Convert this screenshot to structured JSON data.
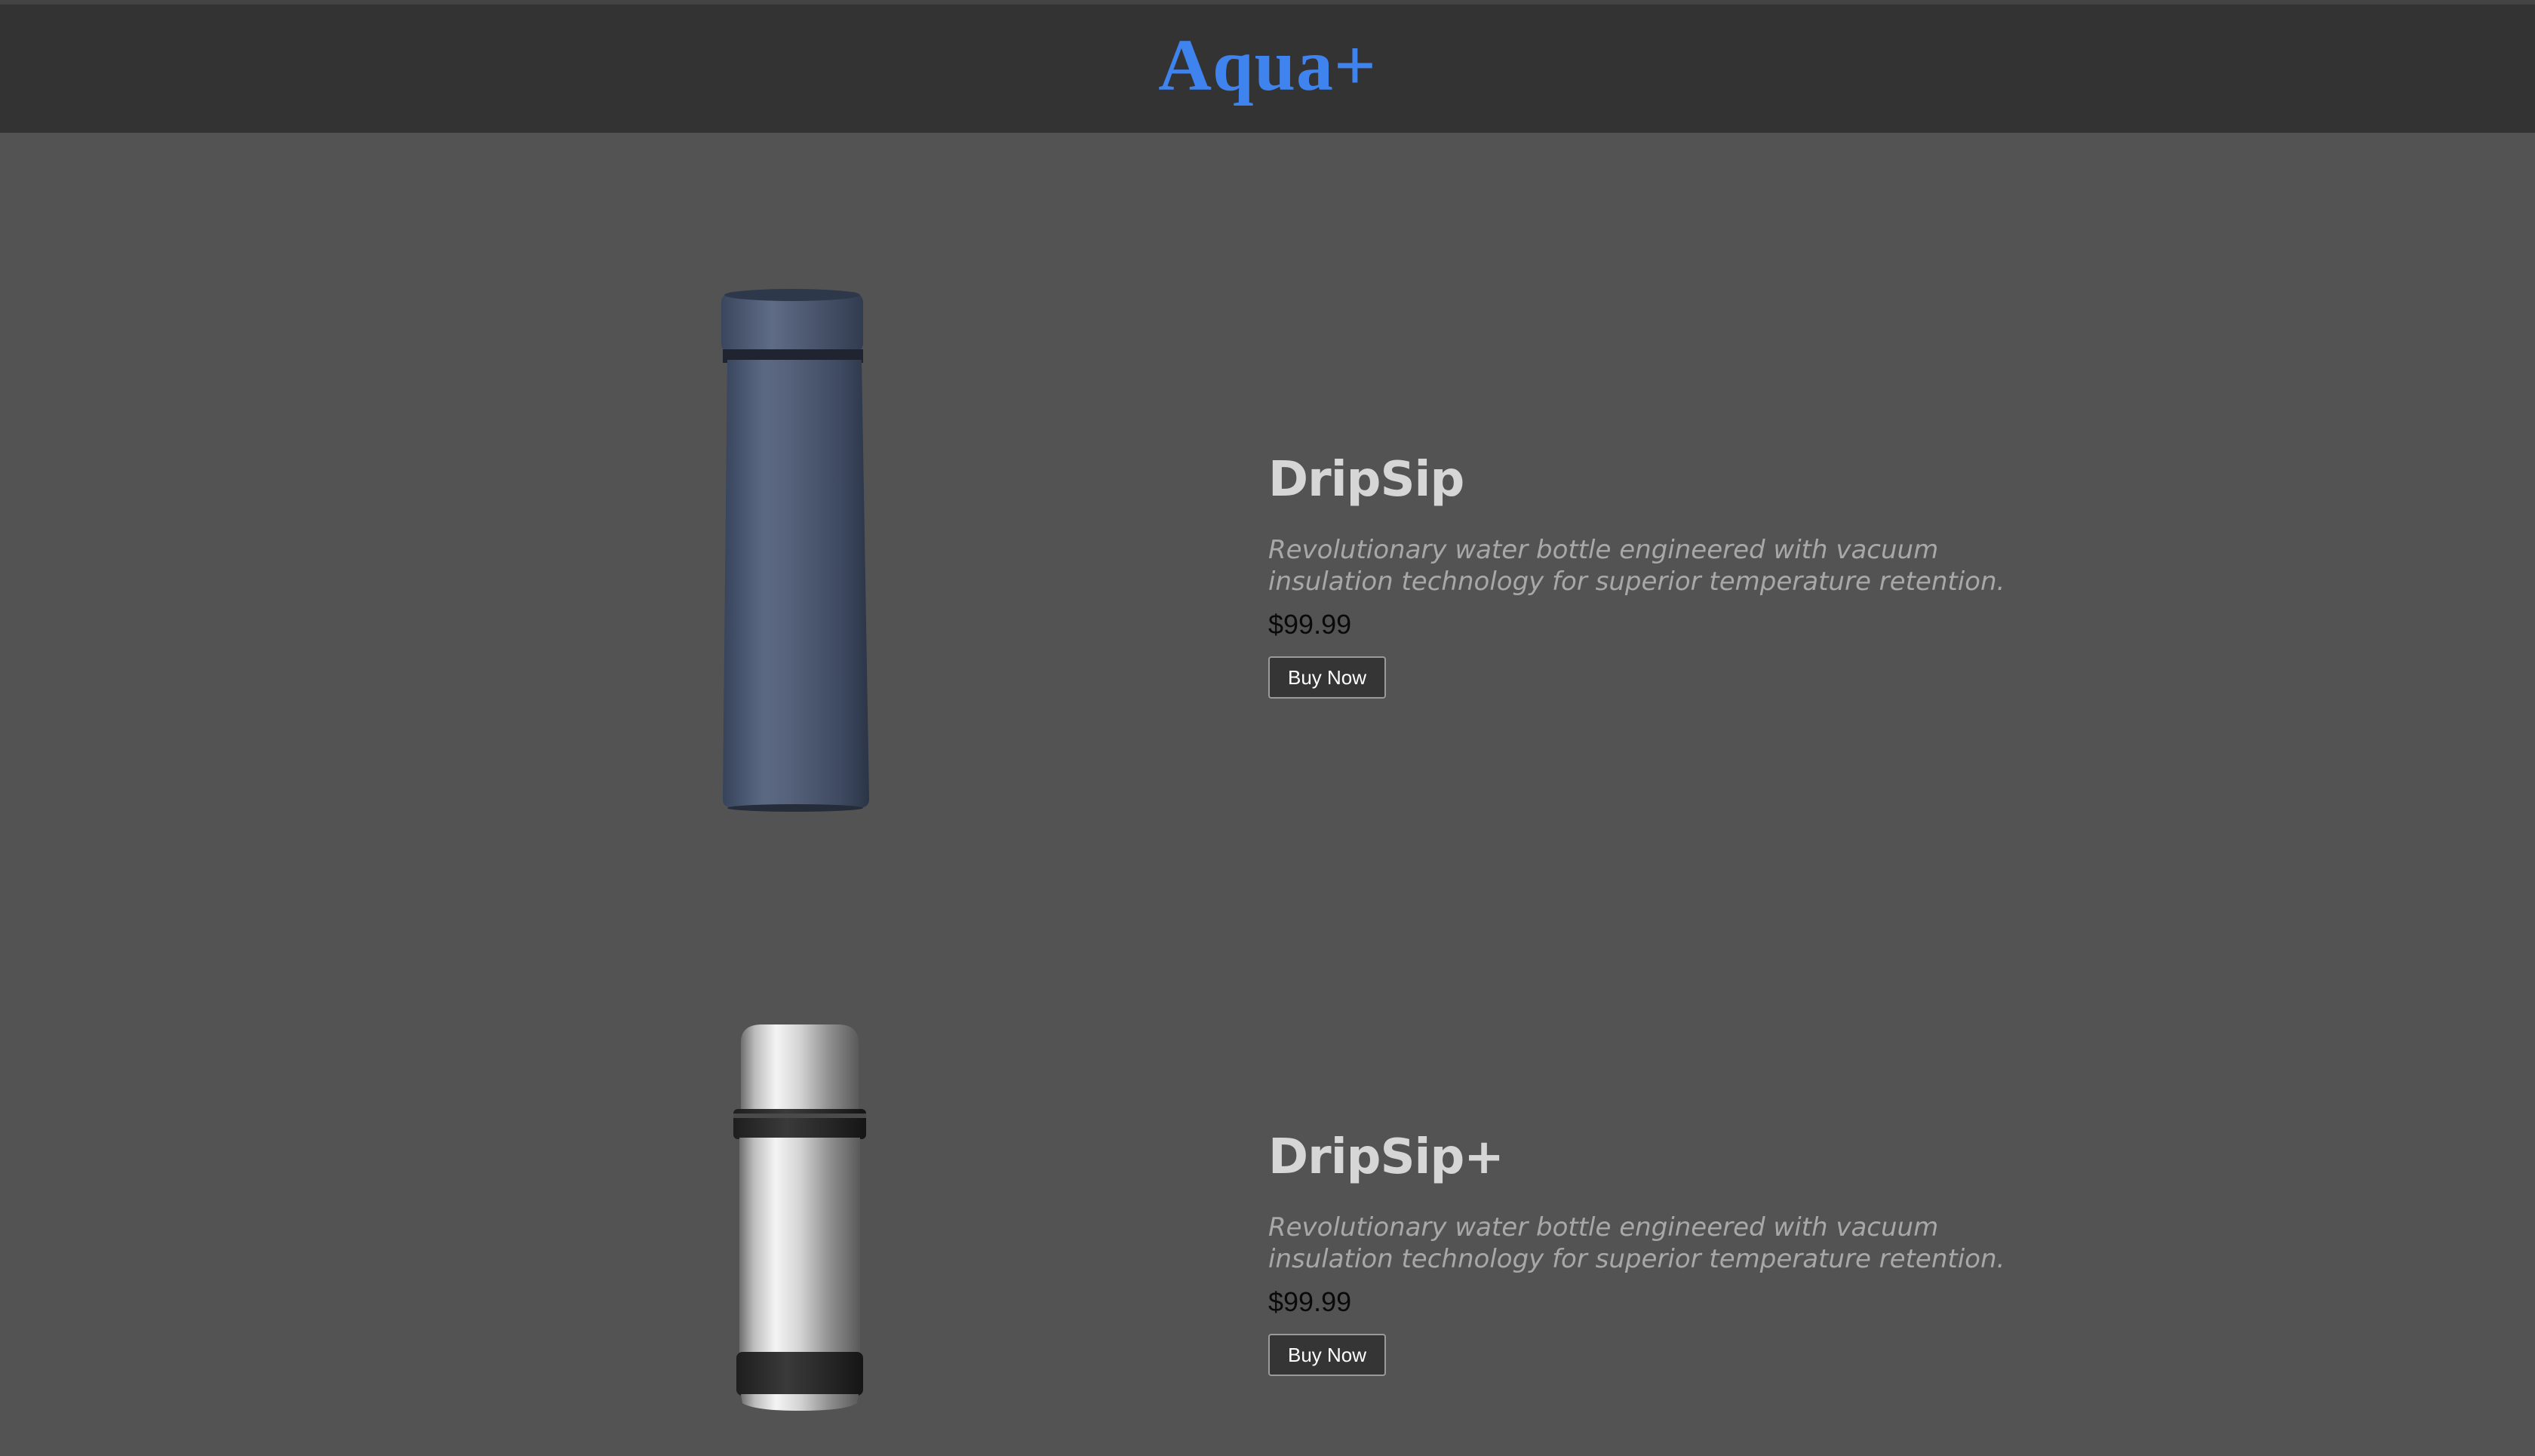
{
  "header": {
    "brand": "Aqua+",
    "brand_color": "#3f83ef",
    "background": "#333333"
  },
  "page": {
    "background": "#535353"
  },
  "products": [
    {
      "name": "DripSip",
      "description": "Revolutionary water bottle engineered with vacuum insulation technology for superior temperature retention.",
      "price": "$99.99",
      "button_label": "Buy Now",
      "image": "navy-insulated-bottle"
    },
    {
      "name": "DripSip+",
      "description": "Revolutionary water bottle engineered with vacuum insulation technology for superior temperature retention.",
      "price": "$99.99",
      "button_label": "Buy Now",
      "image": "stainless-steel-thermos"
    }
  ]
}
